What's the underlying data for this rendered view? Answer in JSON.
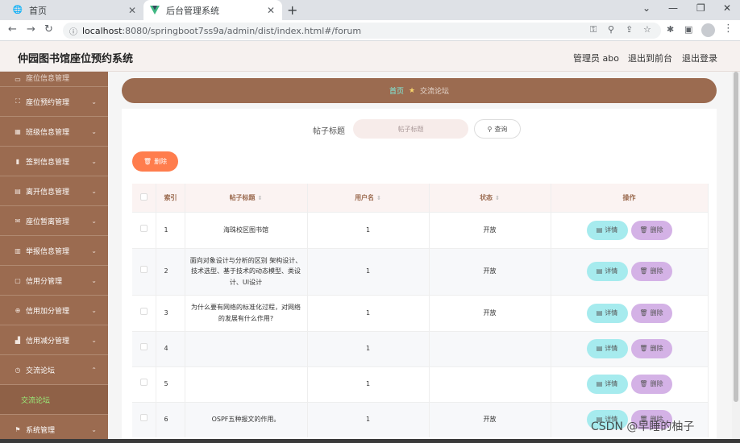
{
  "browser": {
    "tabs": [
      {
        "title": "首页",
        "icon": "globe-icon"
      },
      {
        "title": "后台管理系统",
        "icon": "vue-logo-icon"
      }
    ],
    "url_host": "localhost",
    "url_path": ":8080/springboot7ss9a/admin/dist/index.html#/forum"
  },
  "header": {
    "title": "仲园图书馆座位预约系统",
    "user": "管理员 abo",
    "to_front": "退出到前台",
    "logout": "退出登录"
  },
  "sidebar": {
    "items": [
      {
        "label": "座位信息管理",
        "icon": "seat-icon"
      },
      {
        "label": "座位预约管理",
        "icon": "calendar-icon"
      },
      {
        "label": "班级信息管理",
        "icon": "class-icon"
      },
      {
        "label": "签到信息管理",
        "icon": "chart-icon"
      },
      {
        "label": "离开信息管理",
        "icon": "leave-icon"
      },
      {
        "label": "座位暂离管理",
        "icon": "mail-icon"
      },
      {
        "label": "举报信息管理",
        "icon": "report-icon"
      },
      {
        "label": "信用分管理",
        "icon": "chat-icon"
      },
      {
        "label": "信用加分管理",
        "icon": "plus-circle-icon"
      },
      {
        "label": "信用减分管理",
        "icon": "minus-chart-icon"
      },
      {
        "label": "交流论坛",
        "icon": "clock-icon"
      },
      {
        "label": "系统管理",
        "icon": "flag-icon"
      }
    ],
    "submenu_active": "交流论坛"
  },
  "breadcrumb": {
    "home": "首页",
    "current": "交流论坛"
  },
  "search": {
    "label": "帖子标题",
    "placeholder": "帖子标题",
    "button": "查询"
  },
  "bulk_delete": "删除",
  "table": {
    "headers": {
      "index": "索引",
      "title": "帖子标题",
      "username": "用户名",
      "status": "状态",
      "actions": "操作"
    },
    "rows": [
      {
        "index": "1",
        "title": "海珠校区图书馆",
        "username": "1",
        "status": "开放"
      },
      {
        "index": "2",
        "title": "面向对象设计与分析的区别 架构设计、技术选型、基于技术的动态模型、类设计、UI设计",
        "username": "1",
        "status": "开放"
      },
      {
        "index": "3",
        "title": "为什么要有网络的标准化过程，对网络的发展有什么作用?",
        "username": "1",
        "status": "开放"
      },
      {
        "index": "4",
        "title": "",
        "username": "1",
        "status": ""
      },
      {
        "index": "5",
        "title": "",
        "username": "1",
        "status": ""
      },
      {
        "index": "6",
        "title": "OSPF五种报文的作用。",
        "username": "1",
        "status": "开放"
      }
    ],
    "detail_label": "详情",
    "delete_label": "删除"
  },
  "watermark": "CSDN @早睡的柚子"
}
